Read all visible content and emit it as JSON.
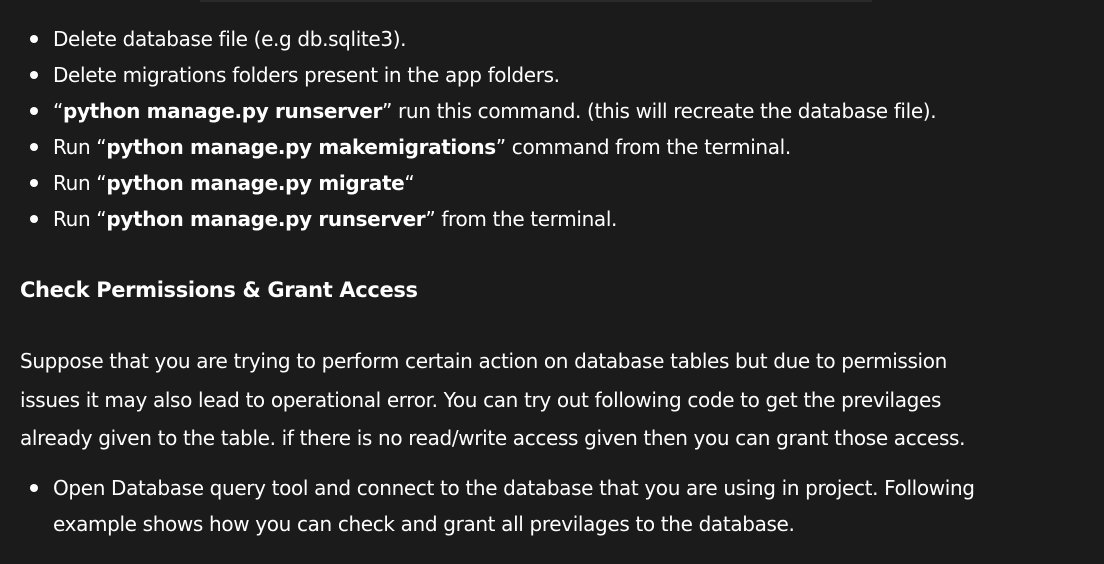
{
  "steps": [
    {
      "before": "",
      "bold": "",
      "after": "Delete database file (e.g db.sqlite3)."
    },
    {
      "before": "",
      "bold": "",
      "after": "Delete migrations folders present in the app folders."
    },
    {
      "before": "“",
      "bold": "python manage.py runserver",
      "after": "” run this command. (this will recreate the database file)."
    },
    {
      "before": "Run “",
      "bold": "python manage.py makemigrations",
      "after": "” command from the terminal."
    },
    {
      "before": "Run “",
      "bold": "python manage.py migrate",
      "after": "“"
    },
    {
      "before": "Run “",
      "bold": "python manage.py runserver",
      "after": "” from the terminal."
    }
  ],
  "section": {
    "heading": "Check Permissions & Grant Access",
    "paragraph_lines": [
      "Suppose that you are trying to perform certain action on database tables but due to permission",
      "issues it may also lead to operational error. You can try out following code to get the previlages",
      "already given to the table. if there is no read/write access given then you can grant those access."
    ],
    "tool_item_lines": [
      "Open Database query tool and connect to the database that you are using in project. Following",
      "example shows how you can check and grant all previlages to the database."
    ]
  }
}
